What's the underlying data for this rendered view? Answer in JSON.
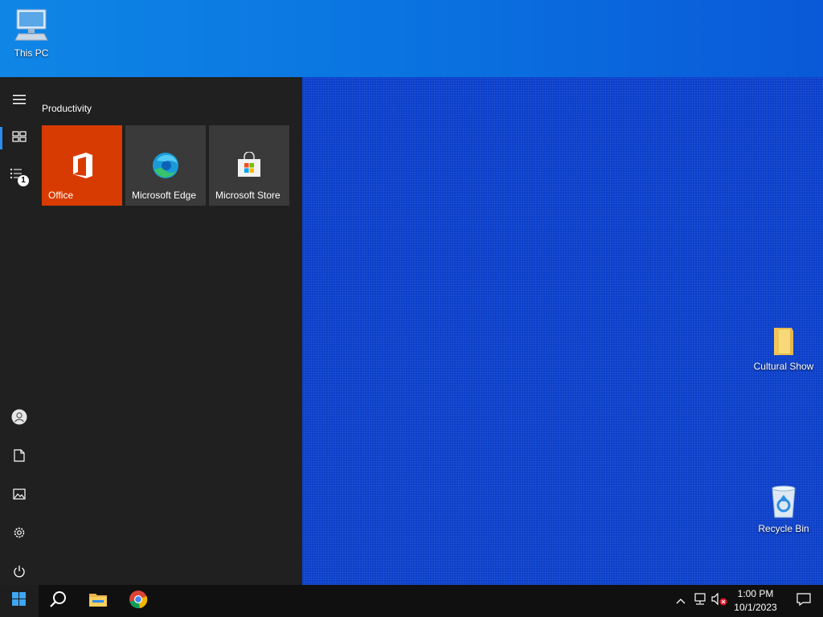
{
  "desktop": {
    "icons": [
      {
        "label": "This PC",
        "icon": "computer-icon"
      },
      {
        "label": "Cultural Show",
        "icon": "folder-icon"
      },
      {
        "label": "Recycle Bin",
        "icon": "recycle-bin-icon"
      }
    ]
  },
  "start_menu": {
    "group_title": "Productivity",
    "tiles": [
      {
        "label": "Office",
        "icon": "office-icon",
        "color": "#d83b01"
      },
      {
        "label": "Microsoft Edge",
        "icon": "edge-icon",
        "color": "#3a3a3a"
      },
      {
        "label": "Microsoft Store",
        "icon": "store-icon",
        "color": "#3a3a3a"
      }
    ],
    "rail": {
      "items": [
        "hamburger-icon",
        "tiles-icon",
        "all-apps-icon",
        "user-icon",
        "documents-icon",
        "pictures-icon",
        "settings-icon",
        "power-icon"
      ],
      "badge": "1"
    }
  },
  "taskbar": {
    "items": [
      "start-icon",
      "search-icon",
      "file-explorer-icon",
      "chrome-icon"
    ],
    "tray": [
      "chevron-up-icon",
      "network-icon",
      "volume-muted-icon"
    ],
    "time": "1:00 PM",
    "date": "10/1/2023",
    "notifications_icon": "notification-icon"
  },
  "colors": {
    "accent": "#2d8cf0",
    "office": "#d83b01",
    "menu_bg": "#202020",
    "taskbar_bg": "#101010"
  }
}
